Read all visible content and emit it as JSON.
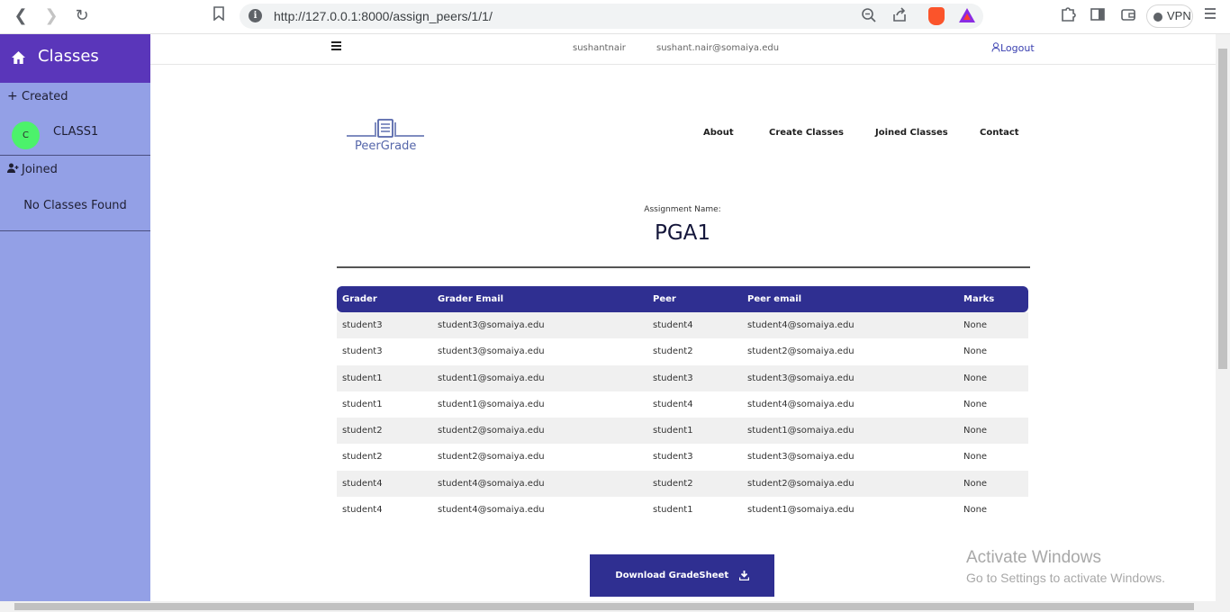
{
  "browser": {
    "url": "http://127.0.0.1:8000/assign_peers/1/1/",
    "vpn_label": "VPN",
    "icons": [
      "back-icon",
      "forward-icon",
      "reload-icon",
      "bookmark-icon",
      "info-icon",
      "zoom-icon",
      "share-icon",
      "brave-shield-icon",
      "brave-rewards-icon",
      "extensions-icon",
      "sidebar-icon",
      "wallet-icon",
      "menu-icon"
    ]
  },
  "sidebar": {
    "title": "Classes",
    "created_label": "Created",
    "created_classes": [
      {
        "avatar": "C",
        "name": "CLASS1"
      }
    ],
    "joined_label": "Joined",
    "joined_empty": "No Classes Found"
  },
  "user_bar": {
    "username": "sushantnair",
    "email": "sushant.nair@somaiya.edu",
    "logout": "Logout"
  },
  "site": {
    "logo_text": "PeerGrade",
    "nav": [
      "About",
      "Create Classes",
      "Joined Classes",
      "Contact"
    ]
  },
  "assignment": {
    "label": "Assignment Name:",
    "name": "PGA1"
  },
  "table": {
    "headers": [
      "Grader",
      "Grader Email",
      "Peer",
      "Peer email",
      "Marks"
    ],
    "rows": [
      [
        "student3",
        "student3@somaiya.edu",
        "student4",
        "student4@somaiya.edu",
        "None"
      ],
      [
        "student3",
        "student3@somaiya.edu",
        "student2",
        "student2@somaiya.edu",
        "None"
      ],
      [
        "student1",
        "student1@somaiya.edu",
        "student3",
        "student3@somaiya.edu",
        "None"
      ],
      [
        "student1",
        "student1@somaiya.edu",
        "student4",
        "student4@somaiya.edu",
        "None"
      ],
      [
        "student2",
        "student2@somaiya.edu",
        "student1",
        "student1@somaiya.edu",
        "None"
      ],
      [
        "student2",
        "student2@somaiya.edu",
        "student3",
        "student3@somaiya.edu",
        "None"
      ],
      [
        "student4",
        "student4@somaiya.edu",
        "student2",
        "student2@somaiya.edu",
        "None"
      ],
      [
        "student4",
        "student4@somaiya.edu",
        "student1",
        "student1@somaiya.edu",
        "None"
      ]
    ]
  },
  "download_label": "Download GradeSheet",
  "watermark": {
    "line1": "Activate Windows",
    "line2": "Go to Settings to activate Windows."
  },
  "colors": {
    "sidebar_bg": "#93a0e6",
    "sidebar_header": "#5a36ba",
    "primary": "#2f2f91",
    "avatar": "#4cf26b"
  }
}
